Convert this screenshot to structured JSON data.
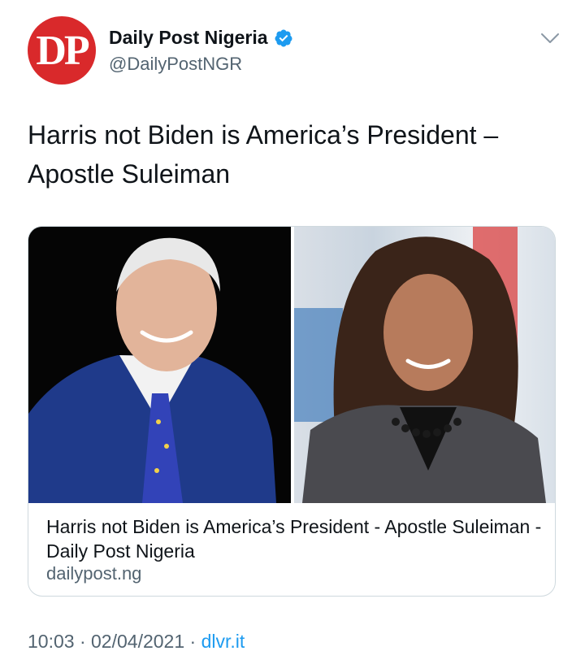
{
  "account": {
    "avatar_text": "DP",
    "display_name": "Daily Post Nigeria",
    "handle": "@DailyPostNGR",
    "verified_icon": "verified-badge-icon"
  },
  "tweet": {
    "text": "Harris not Biden is America’s President – Apostle Suleiman"
  },
  "card": {
    "title": "Harris not Biden is America’s President - Apostle Suleiman - Daily Post Nigeria",
    "domain": "dailypost.ng"
  },
  "meta": {
    "time": "10:03",
    "sep1": " · ",
    "date": "02/04/2021",
    "sep2": " · ",
    "source": "dlvr.it"
  },
  "colors": {
    "avatar_bg": "#d9292b",
    "verified_blue": "#1d9bf0",
    "link_blue": "#1d9bf0",
    "secondary_text": "#536471"
  }
}
